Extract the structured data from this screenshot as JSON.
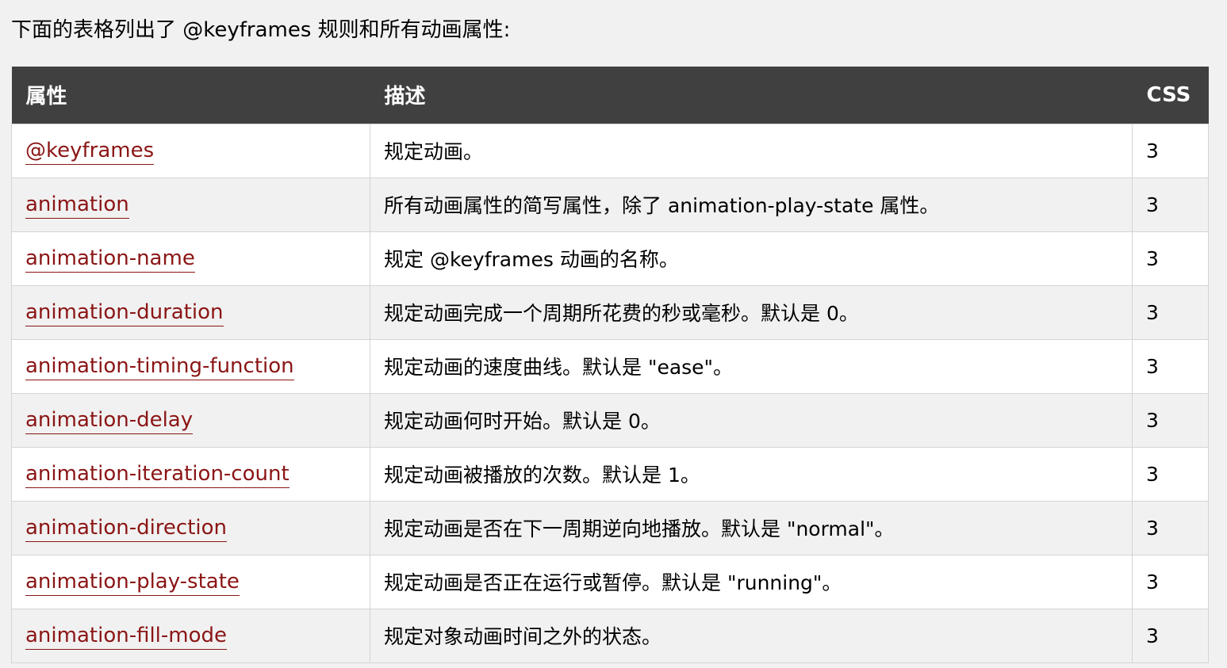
{
  "intro_text": "下面的表格列出了 @keyframes 规则和所有动画属性:",
  "table": {
    "headers": {
      "property": "属性",
      "description": "描述",
      "css": "CSS"
    },
    "rows": [
      {
        "property": "@keyframes",
        "description": "规定动画。",
        "css": "3"
      },
      {
        "property": "animation",
        "description": "所有动画属性的简写属性，除了 animation-play-state 属性。",
        "css": "3"
      },
      {
        "property": "animation-name",
        "description": "规定 @keyframes 动画的名称。",
        "css": "3"
      },
      {
        "property": "animation-duration",
        "description": "规定动画完成一个周期所花费的秒或毫秒。默认是 0。",
        "css": "3"
      },
      {
        "property": "animation-timing-function",
        "description": "规定动画的速度曲线。默认是 \"ease\"。",
        "css": "3"
      },
      {
        "property": "animation-delay",
        "description": "规定动画何时开始。默认是 0。",
        "css": "3"
      },
      {
        "property": "animation-iteration-count",
        "description": "规定动画被播放的次数。默认是 1。",
        "css": "3"
      },
      {
        "property": "animation-direction",
        "description": "规定动画是否在下一周期逆向地播放。默认是 \"normal\"。",
        "css": "3"
      },
      {
        "property": "animation-play-state",
        "description": "规定动画是否正在运行或暂停。默认是 \"running\"。",
        "css": "3"
      },
      {
        "property": "animation-fill-mode",
        "description": "规定对象动画时间之外的状态。",
        "css": "3"
      }
    ]
  },
  "colors": {
    "header_bg": "#404040",
    "link": "#8b1515",
    "row_alt": "#f1f1f1"
  }
}
